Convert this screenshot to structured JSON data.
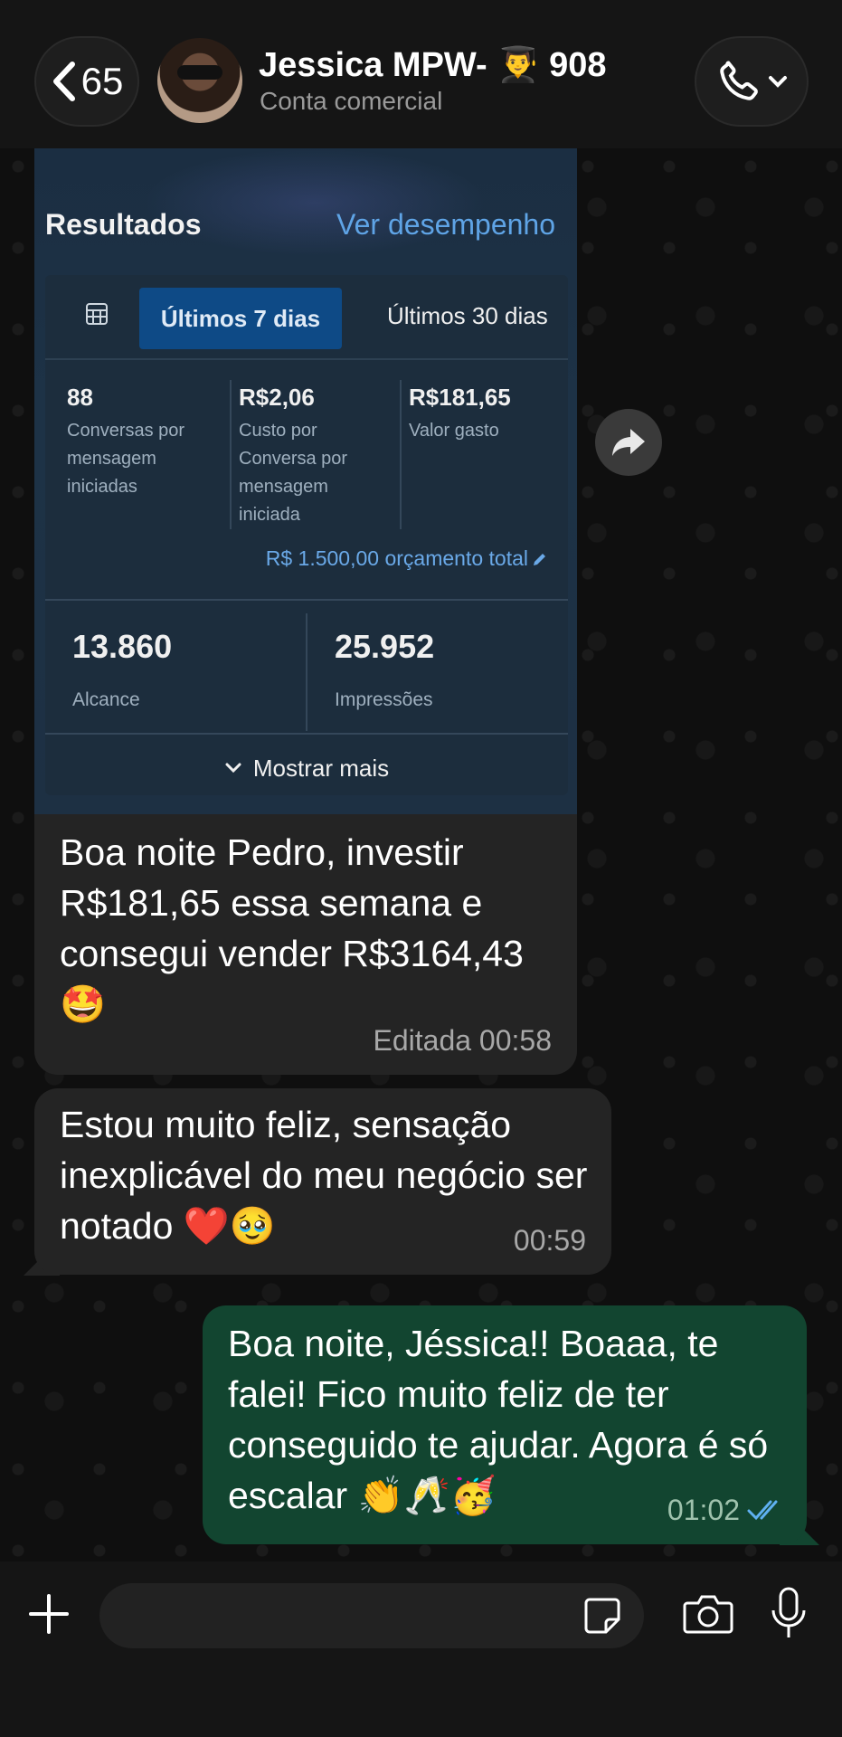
{
  "header": {
    "back_count": "65",
    "contact_name": "Jessica MPW- 👨‍🎓 908",
    "contact_subtitle": "Conta comercial"
  },
  "ad_card": {
    "title": "Resultados",
    "link": "Ver desempenho",
    "tabs": {
      "active": "Últimos 7 dias",
      "inactive": "Últimos 30 dias"
    },
    "metrics": [
      {
        "value": "88",
        "label": "Conversas por mensagem iniciadas"
      },
      {
        "value": "R$2,06",
        "label": "Custo por Conversa por mensagem iniciada"
      },
      {
        "value": "R$181,65",
        "label": "Valor gasto"
      }
    ],
    "budget": "R$ 1.500,00 orçamento total",
    "reach": {
      "value": "13.860",
      "label": "Alcance"
    },
    "impressions": {
      "value": "25.952",
      "label": "Impressões"
    },
    "show_more": "Mostrar mais"
  },
  "messages": [
    {
      "text": "Boa noite Pedro, investir R$181,65 essa semana e consegui vender R$3164,43 🤩",
      "meta": "Editada 00:58"
    },
    {
      "text": "Estou muito feliz, sensação inexplicável do meu negócio ser notado ❤️🥹",
      "meta": "00:59"
    },
    {
      "text": "Boa noite, Jéssica!! Boaaa, te falei! Fico muito feliz de ter conseguido te ajudar. Agora é só escalar 👏🥂🥳",
      "meta": "01:02"
    }
  ],
  "composer": {
    "placeholder": ""
  },
  "colors": {
    "outgoing": "#124530",
    "incoming": "#242424",
    "link": "#5fa4e6",
    "read_ticks": "#5fb0f0"
  }
}
